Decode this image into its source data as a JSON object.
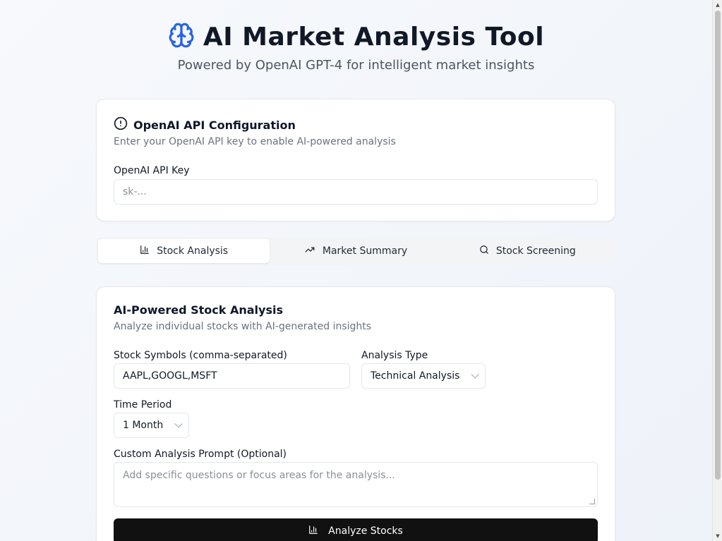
{
  "header": {
    "title": "AI Market Analysis Tool",
    "subtitle": "Powered by OpenAI GPT-4 for intelligent market insights",
    "icon": "brain-icon",
    "icon_color": "#2563eb"
  },
  "api_config": {
    "title": "OpenAI API Configuration",
    "description": "Enter your OpenAI API key to enable AI-powered analysis",
    "key_label": "OpenAI API Key",
    "key_placeholder": "sk-...",
    "key_value": ""
  },
  "tabs": [
    {
      "label": "Stock Analysis",
      "icon": "bar-chart-icon",
      "active": true
    },
    {
      "label": "Market Summary",
      "icon": "trending-up-icon",
      "active": false
    },
    {
      "label": "Stock Screening",
      "icon": "search-icon",
      "active": false
    }
  ],
  "analysis": {
    "title": "AI-Powered Stock Analysis",
    "description": "Analyze individual stocks with AI-generated insights",
    "symbols_label": "Stock Symbols (comma-separated)",
    "symbols_value": "AAPL,GOOGL,MSFT",
    "type_label": "Analysis Type",
    "type_value": "Technical Analysis",
    "period_label": "Time Period",
    "period_value": "1 Month",
    "prompt_label": "Custom Analysis Prompt (Optional)",
    "prompt_placeholder": "Add specific questions or focus areas for the analysis...",
    "submit_label": "Analyze Stocks"
  }
}
